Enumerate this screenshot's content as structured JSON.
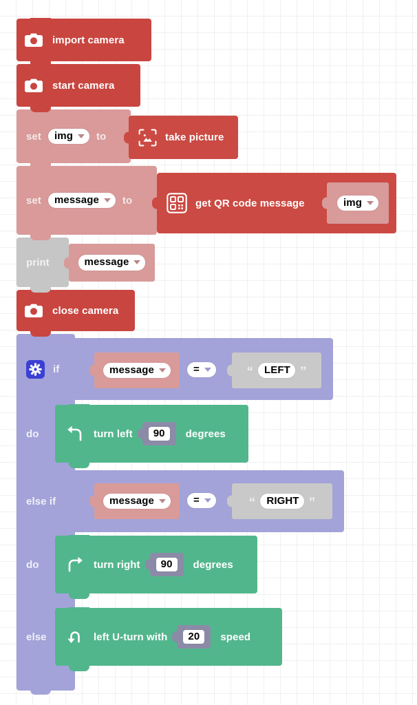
{
  "workspace": {
    "name": "blockly-workspace",
    "grid_size_px": 24,
    "colors": {
      "camera_red": "#c9453f",
      "variable_salmon": "#d99a99",
      "print_grey": "#c6c6c6",
      "text_grey": "#c9c9c9",
      "logic_purple": "#a3a3d9",
      "motion_green": "#52b68d",
      "number_socket": "#8b8ba8",
      "gear_blue": "#3b3fd4"
    }
  },
  "blocks": {
    "import_camera": {
      "label": "import camera",
      "icon": "camera-icon"
    },
    "start_camera": {
      "label": "start camera",
      "icon": "camera-icon"
    },
    "set_img": {
      "set_label": "set",
      "variable": "img",
      "to_label": "to",
      "value": {
        "label": "take picture",
        "icon": "take-picture-icon"
      }
    },
    "set_message": {
      "set_label": "set",
      "variable": "message",
      "to_label": "to",
      "value": {
        "label": "get QR code message",
        "icon": "qr-code-icon",
        "argument": "img"
      }
    },
    "print": {
      "label": "print",
      "value": "message"
    },
    "close_camera": {
      "label": "close camera",
      "icon": "camera-icon"
    },
    "if_block": {
      "gear_icon": "gear-icon",
      "if_label": "if",
      "do_label": "do",
      "else_if_label": "else if",
      "else_label": "else",
      "branches": [
        {
          "keyword": "if",
          "condition": {
            "left": "message",
            "operator": "=",
            "right": "LEFT"
          },
          "do_label": "do",
          "body": {
            "label_before": "turn left",
            "value": "90",
            "label_after": "degrees",
            "icon": "turn-left-icon"
          }
        },
        {
          "keyword": "else if",
          "condition": {
            "left": "message",
            "operator": "=",
            "right": "RIGHT"
          },
          "do_label": "do",
          "body": {
            "label_before": "turn right",
            "value": "90",
            "label_after": "degrees",
            "icon": "turn-right-icon"
          }
        },
        {
          "keyword": "else",
          "body": {
            "label_before": "left U-turn with",
            "value": "20",
            "label_after": "speed",
            "icon": "u-turn-icon"
          }
        }
      ]
    }
  }
}
